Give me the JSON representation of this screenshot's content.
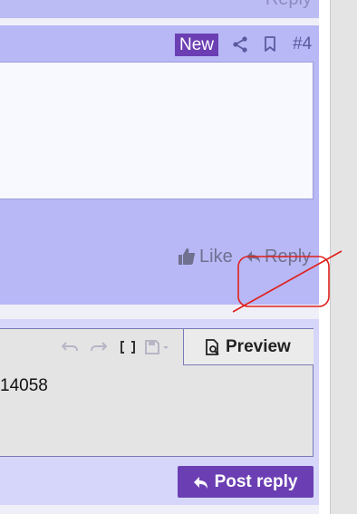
{
  "previous_post": {
    "reply_label": "Reply"
  },
  "post": {
    "badge": "New",
    "number": "#4",
    "actions": {
      "like_label": "Like",
      "reply_label": "Reply"
    }
  },
  "reply_editor": {
    "preview_label": "Preview",
    "content_text": "14058",
    "submit_label": "Post reply"
  },
  "colors": {
    "accent": "#6b3fb3",
    "post_background": "#b8b8f6",
    "annotation": "#e0201c"
  },
  "icons": [
    "share-icon",
    "bookmark-icon",
    "thumbs-up-icon",
    "reply-icon",
    "undo-icon",
    "redo-icon",
    "bbcode-icon",
    "save-draft-icon",
    "preview-icon"
  ]
}
